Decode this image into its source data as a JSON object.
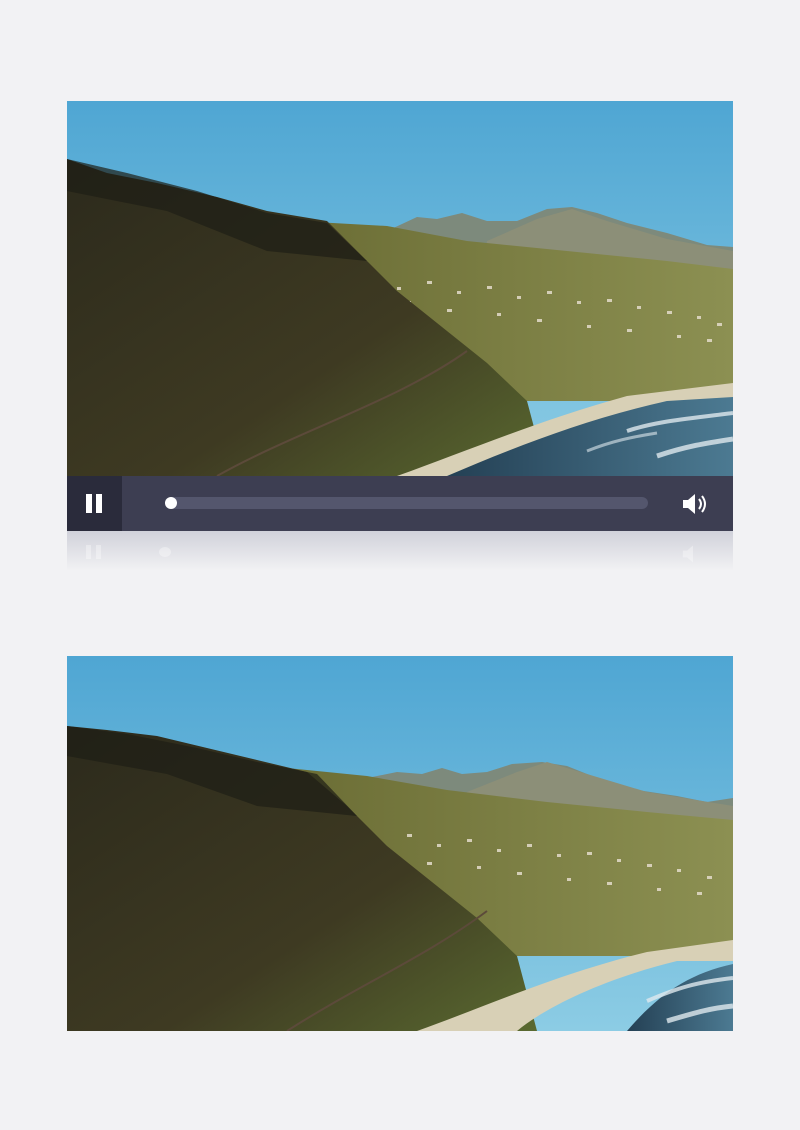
{
  "video_player": {
    "state": "playing",
    "play_pause_icon": "pause-icon",
    "volume_icon": "speaker-volume-icon",
    "progress_fraction": 0.0
  },
  "colors": {
    "bar_background": "#3d3e52",
    "play_button_background": "#2a2b3b",
    "track": "#54566d",
    "knob": "#ffffff",
    "page_background": "#f2f2f4"
  },
  "scene": {
    "description_icon": "coastal-landscape-image"
  }
}
